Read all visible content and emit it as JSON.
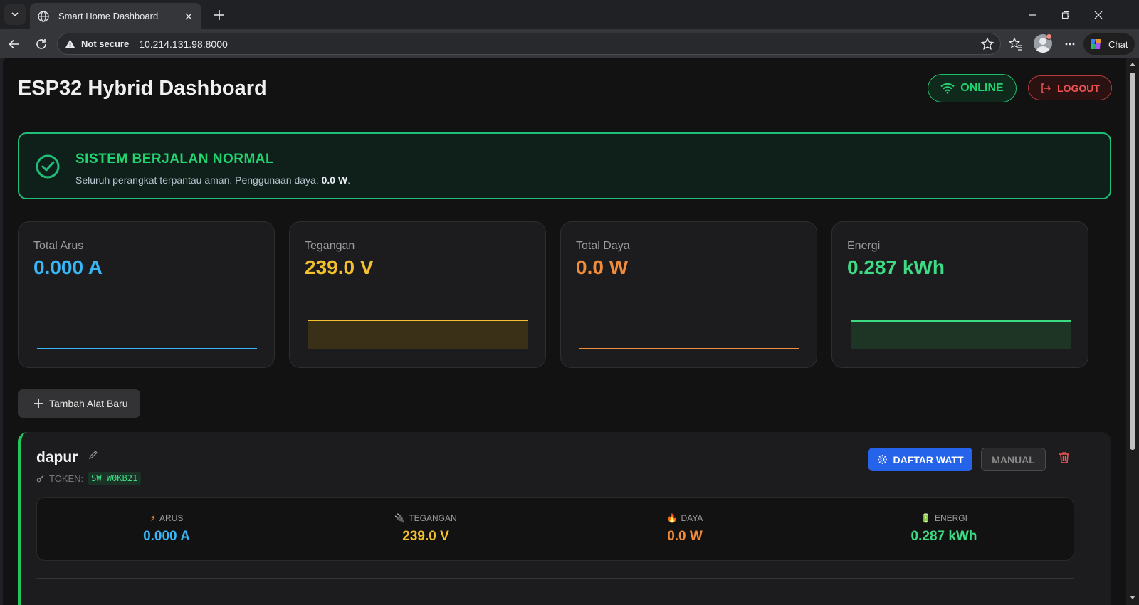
{
  "browser": {
    "tab_title": "Smart Home Dashboard",
    "security_label": "Not secure",
    "url": "10.214.131.98:8000",
    "chat_label": "Chat"
  },
  "header": {
    "title": "ESP32 Hybrid Dashboard",
    "status_label": "ONLINE",
    "logout_label": "LOGOUT"
  },
  "alert": {
    "title": "SISTEM BERJALAN NORMAL",
    "message_prefix": "Seluruh perangkat terpantau aman. Penggunaan daya: ",
    "message_value": "0.0 W",
    "message_suffix": "."
  },
  "stats": [
    {
      "label": "Total Arus",
      "value": "0.000 A",
      "color": "#38b6f5"
    },
    {
      "label": "Tegangan",
      "value": "239.0 V",
      "color": "#f5c02e"
    },
    {
      "label": "Total Daya",
      "value": "0.0 W",
      "color": "#f28c3a"
    },
    {
      "label": "Energi",
      "value": "0.287 kWh",
      "color": "#3ddc84"
    }
  ],
  "add_button_label": "Tambah Alat Baru",
  "device": {
    "name": "dapur",
    "token_label": "TOKEN:",
    "token_value": "SW_W0KB21",
    "daftar_label": "DAFTAR WATT",
    "manual_label": "MANUAL",
    "metrics": [
      {
        "label": "ARUS",
        "value": "0.000 A",
        "icon": "bolt-icon",
        "color": "#38b6f5"
      },
      {
        "label": "TEGANGAN",
        "value": "239.0 V",
        "icon": "plug-icon",
        "color": "#f5c02e"
      },
      {
        "label": "DAYA",
        "value": "0.0 W",
        "icon": "fire-icon",
        "color": "#f28c3a"
      },
      {
        "label": "ENERGI",
        "value": "0.287 kWh",
        "icon": "battery-icon",
        "color": "#3ddc84"
      }
    ]
  }
}
